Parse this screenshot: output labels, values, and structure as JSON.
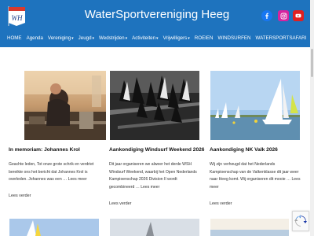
{
  "site": {
    "title": "WaterSportvereniging Heeg",
    "logo_icon": "wsh-pennant-logo",
    "brand_color": "#1e73be"
  },
  "social": [
    {
      "name": "facebook-icon",
      "color": "#1877f2"
    },
    {
      "name": "instagram-icon",
      "color": "#d6249f"
    },
    {
      "name": "youtube-icon",
      "color": "#e02020"
    }
  ],
  "nav": {
    "items": [
      {
        "label": "HOME",
        "dropdown": false
      },
      {
        "label": "Agenda",
        "dropdown": false
      },
      {
        "label": "Vereniging",
        "dropdown": true
      },
      {
        "label": "Jeugd",
        "dropdown": true
      },
      {
        "label": "Wedstrijden",
        "dropdown": true
      },
      {
        "label": "Activiteiten",
        "dropdown": true
      },
      {
        "label": "Vrijwilligers",
        "dropdown": true
      },
      {
        "label": "ROEIEN",
        "dropdown": false
      },
      {
        "label": "WINDSURFEN",
        "dropdown": false
      },
      {
        "label": "WATERSPORTSAFARI",
        "dropdown": false
      }
    ]
  },
  "posts": [
    {
      "title": "In memoriam: Johannes Krol",
      "excerpt": "Geachte leden, Tot onze grote schrik en verdriet bereikte ons het bericht dat Johannes Krol is overleden. Johannes was een … Lees meer",
      "more": "Lees verder"
    },
    {
      "title": "Aankondiging Windsurf Weekend 2026",
      "excerpt": "Dit jaar organiseren we alweer het derde WSH Windsurf Weekend, waarbij het Open Nederlands Kampioenschap 2026 Division II wordt gecombineerd … Lees meer",
      "more": "Lees verder"
    },
    {
      "title": "Aankondiging NK Valk 2026",
      "excerpt": "Wij zijn verheugd dat het Nederlands Kampioenschap van de Valkenklasse dit jaar weer naar Heeg komt. Wij organiseren dit mooie … Lees meer",
      "more": "Lees verder"
    }
  ]
}
